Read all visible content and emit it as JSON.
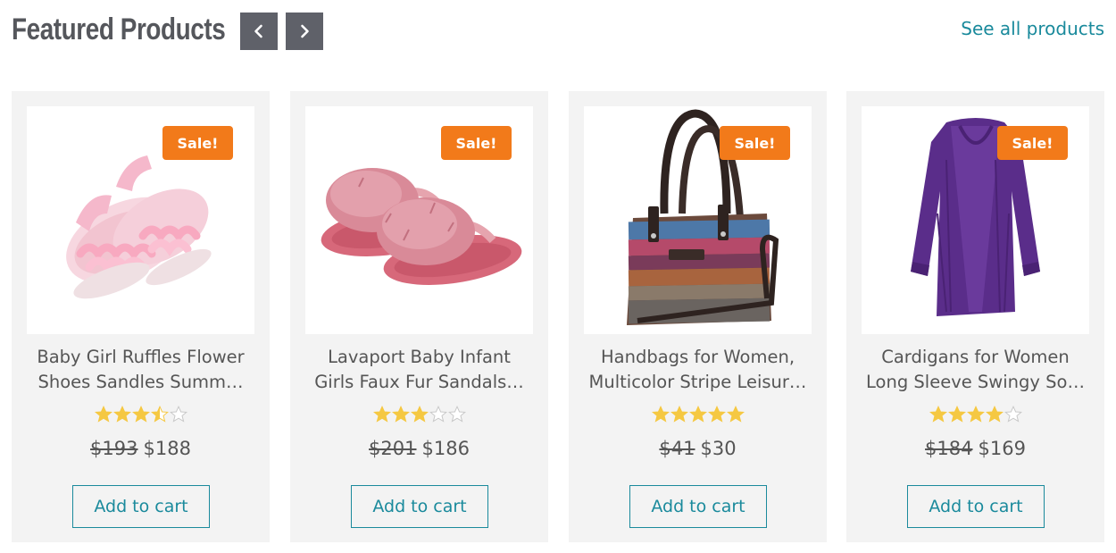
{
  "header": {
    "title": "Featured Products",
    "prev_icon": "chevron-left-icon",
    "next_icon": "chevron-right-icon",
    "see_all": "See all products"
  },
  "colors": {
    "accent": "#1a8a9c",
    "sale_badge": "#f27a1a",
    "star": "#f5c842",
    "nav_button": "#5f6169"
  },
  "products": [
    {
      "name_line1": "Baby Girl Ruffles Flower",
      "name_line2": "Shoes Sandles Summ…",
      "badge": "Sale!",
      "rating": 3.5,
      "old_price": "$193",
      "price": "$188",
      "cta": "Add to cart",
      "image": "pink-ruffle-sandals-image"
    },
    {
      "name_line1": "Lavaport Baby Infant",
      "name_line2": "Girls Faux Fur Sandals…",
      "badge": "Sale!",
      "rating": 3,
      "old_price": "$201",
      "price": "$186",
      "cta": "Add to cart",
      "image": "pink-fur-sandals-image"
    },
    {
      "name_line1": "Handbags for Women,",
      "name_line2": "Multicolor Stripe Leisur…",
      "badge": "Sale!",
      "rating": 5,
      "old_price": "$41",
      "price": "$30",
      "cta": "Add to cart",
      "image": "striped-handbag-image"
    },
    {
      "name_line1": "Cardigans for Women",
      "name_line2": "Long Sleeve Swingy So…",
      "badge": "Sale!",
      "rating": 4,
      "old_price": "$184",
      "price": "$169",
      "cta": "Add to cart",
      "image": "purple-cardigan-image"
    }
  ]
}
